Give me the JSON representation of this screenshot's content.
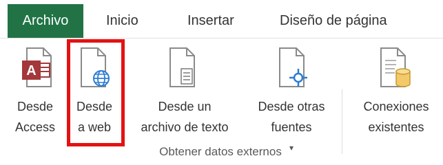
{
  "tabs": {
    "file": "Archivo",
    "inicio": "Inicio",
    "insertar": "Insertar",
    "diseno": "Diseño de página"
  },
  "ribbon": {
    "commands": {
      "access": {
        "line1": "Desde",
        "line2": "Access",
        "icon": "access-database-icon"
      },
      "web": {
        "line1": "Desde",
        "line2": "a web",
        "icon": "web-page-icon"
      },
      "texto": {
        "line1": "Desde un",
        "line2": "archivo de texto",
        "icon": "text-file-icon"
      },
      "otras": {
        "line1": "Desde otras",
        "line2": "fuentes",
        "caret": "▾",
        "icon": "other-sources-icon"
      },
      "conex": {
        "line1": "Conexiones",
        "line2": "existentes",
        "icon": "existing-connections-icon"
      }
    },
    "group_label": "Obtener datos externos"
  },
  "colors": {
    "file_tab": "#217346",
    "highlight": "#e31212",
    "access_red": "#a4373a",
    "web_blue": "#2b7cd3"
  }
}
